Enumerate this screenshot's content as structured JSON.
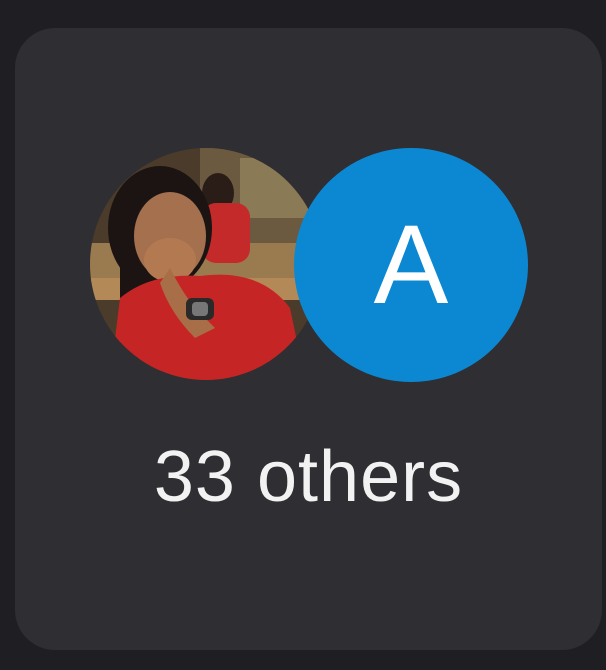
{
  "card": {
    "background": "#2f2e33",
    "avatars": [
      {
        "kind": "photo",
        "icon": "user-photo-icon"
      },
      {
        "kind": "initial",
        "initial": "A",
        "color": "#0c88d2"
      }
    ],
    "others_label": "33 others"
  }
}
